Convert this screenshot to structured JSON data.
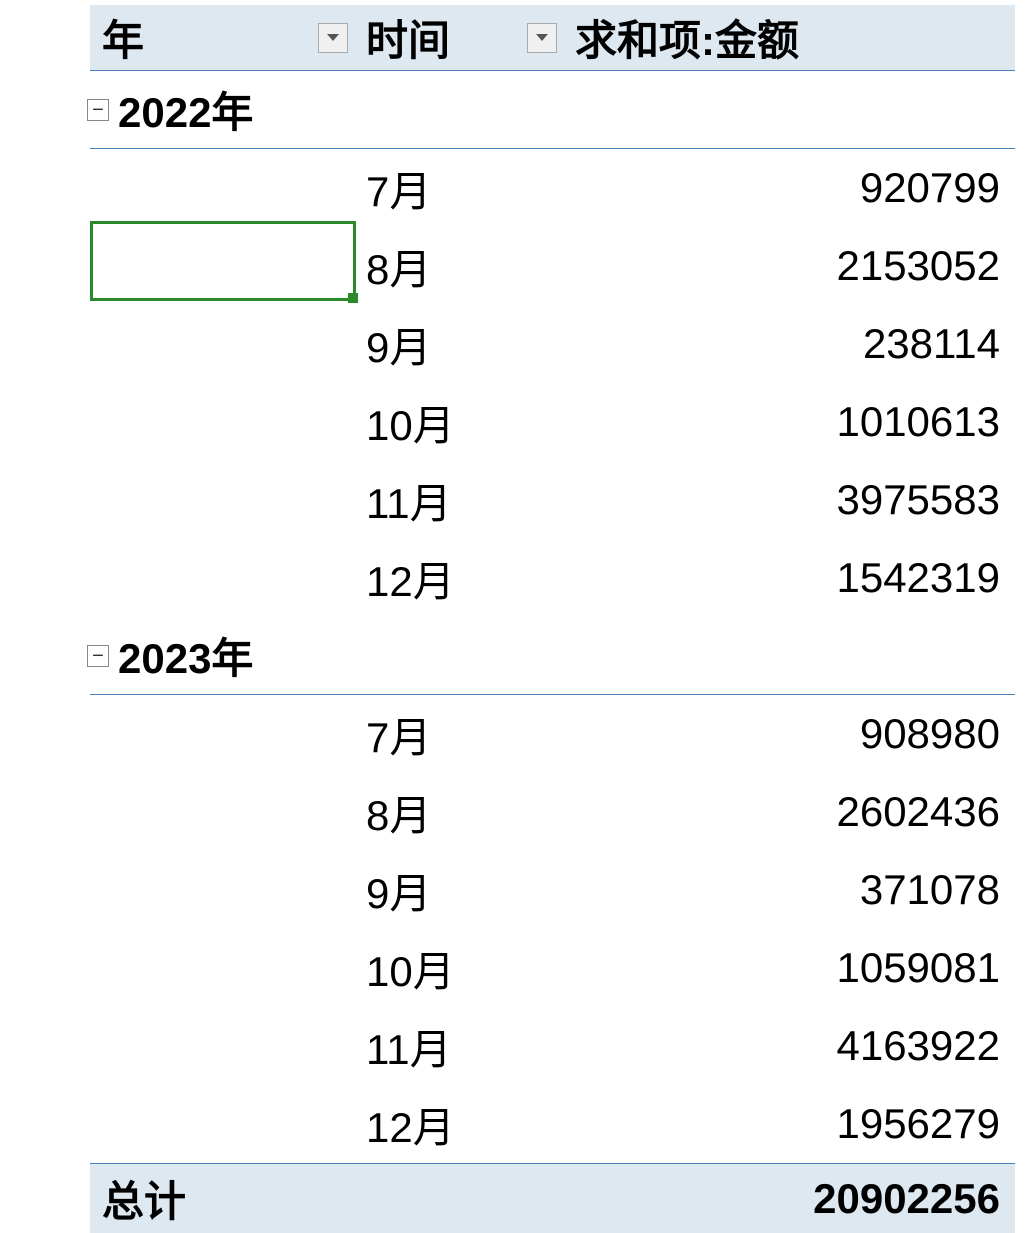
{
  "headers": {
    "year": "年",
    "time": "时间",
    "sum": "求和项:金额"
  },
  "groups": [
    {
      "label": "2022年",
      "rows": [
        {
          "time": "7月",
          "value": "920799"
        },
        {
          "time": "8月",
          "value": "2153052"
        },
        {
          "time": "9月",
          "value": "238114"
        },
        {
          "time": "10月",
          "value": "1010613"
        },
        {
          "time": "11月",
          "value": "3975583"
        },
        {
          "time": "12月",
          "value": "1542319"
        }
      ]
    },
    {
      "label": "2023年",
      "rows": [
        {
          "time": "7月",
          "value": "908980"
        },
        {
          "time": "8月",
          "value": "2602436"
        },
        {
          "time": "9月",
          "value": "371078"
        },
        {
          "time": "10月",
          "value": "1059081"
        },
        {
          "time": "11月",
          "value": "4163922"
        },
        {
          "time": "12月",
          "value": "1956279"
        }
      ]
    }
  ],
  "total": {
    "label": "总计",
    "value": "20902256"
  },
  "icons": {
    "collapse": "−"
  }
}
